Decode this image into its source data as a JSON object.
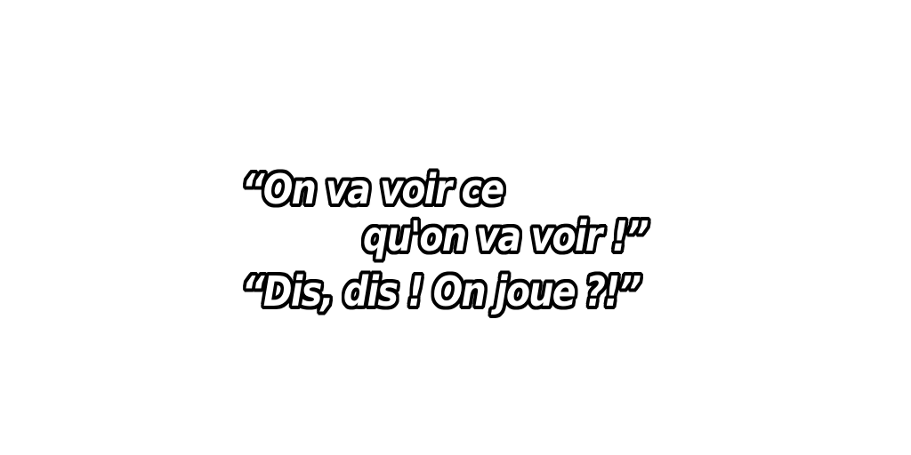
{
  "quotes": {
    "line1": "“On va voir ce",
    "line2": "qu'on va voir !”",
    "line3": "“Dis, dis ! On joue ?!”"
  },
  "colors": {
    "text_fill": "#ffffff",
    "text_outline": "#000000",
    "background": "#ffffff"
  }
}
